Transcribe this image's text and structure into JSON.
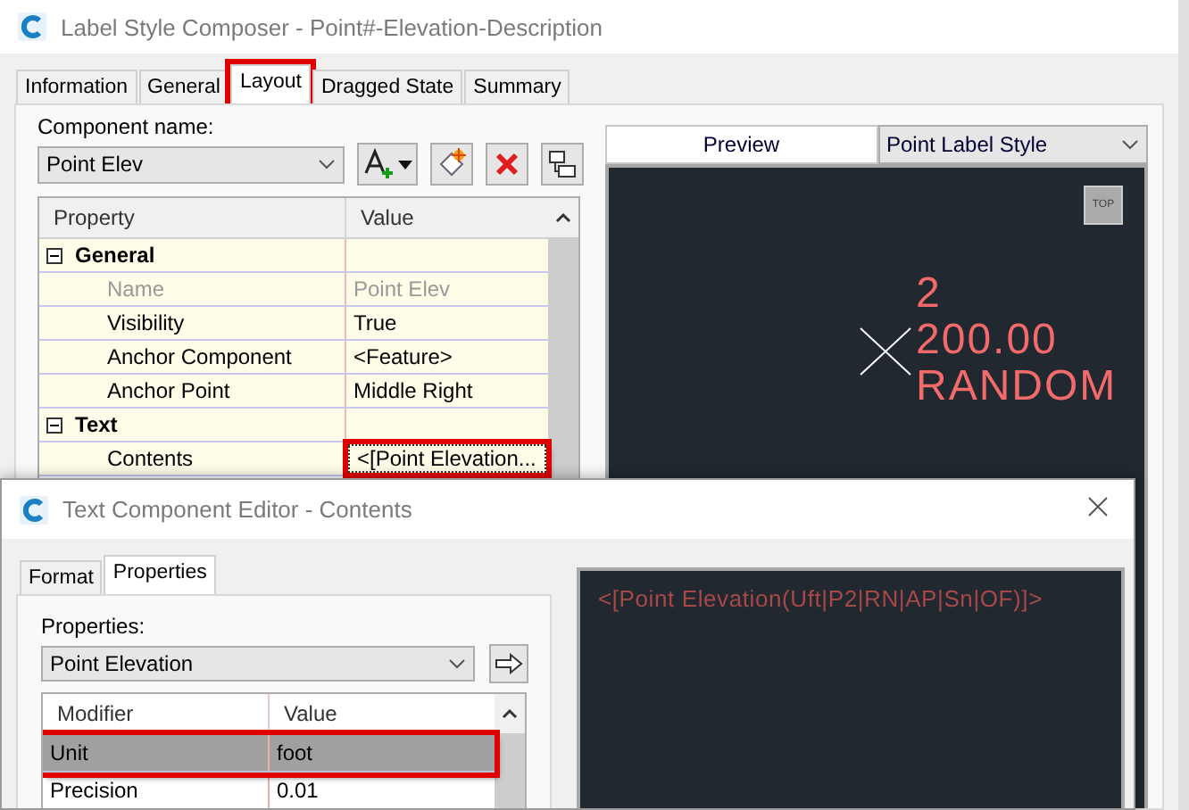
{
  "back_window": {
    "title": "Label Style Composer - Point#-Elevation-Description",
    "tabs": [
      {
        "label": "Information",
        "selected": false,
        "highlighted": false
      },
      {
        "label": "General",
        "selected": false,
        "highlighted": false
      },
      {
        "label": "Layout",
        "selected": true,
        "highlighted": true
      },
      {
        "label": "Dragged State",
        "selected": false,
        "highlighted": false
      },
      {
        "label": "Summary",
        "selected": false,
        "highlighted": false
      }
    ],
    "component_label": "Component name:",
    "component": "Point Elev",
    "columns": [
      "Property",
      "Value"
    ],
    "rows": [
      {
        "kind": "category",
        "label": "General",
        "expanded": true
      },
      {
        "kind": "property",
        "label": "Name",
        "value": "Point Elev",
        "disabled": true,
        "highlighted": false
      },
      {
        "kind": "property",
        "label": "Visibility",
        "value": "True",
        "disabled": false,
        "highlighted": false
      },
      {
        "kind": "property",
        "label": "Anchor Component",
        "value": "<Feature>",
        "disabled": false,
        "highlighted": false
      },
      {
        "kind": "property",
        "label": "Anchor Point",
        "value": "Middle Right",
        "disabled": false,
        "highlighted": false
      },
      {
        "kind": "category",
        "label": "Text",
        "expanded": true
      },
      {
        "kind": "property",
        "label": "Contents",
        "value": "<[Point Elevation...",
        "disabled": false,
        "highlighted": true
      }
    ],
    "preview_tab": "Preview",
    "style_select": "Point Label Style",
    "view_cube": "TOP",
    "label_lines": [
      "2",
      "200.00",
      "RANDOM"
    ]
  },
  "front_window": {
    "title": "Text Component Editor - Contents",
    "tabs": [
      {
        "label": "Format",
        "selected": false,
        "highlighted": false
      },
      {
        "label": "Properties",
        "selected": true,
        "highlighted": false
      }
    ],
    "properties_label": "Properties:",
    "property": "Point Elevation",
    "columns": [
      "Modifier",
      "Value"
    ],
    "rows": [
      {
        "label": "Unit",
        "value": "foot",
        "selected": true,
        "highlighted": true
      },
      {
        "label": "Precision",
        "value": "0.01",
        "selected": false,
        "highlighted": false
      }
    ],
    "contents": "<[Point Elevation(Uft|P2|RN|AP|Sn|OF)]>"
  }
}
